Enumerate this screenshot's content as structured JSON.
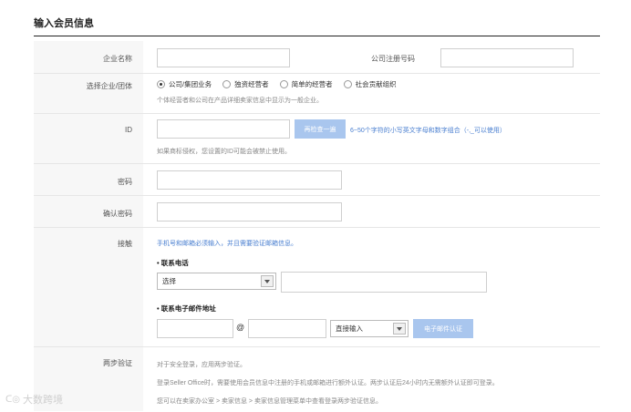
{
  "page": {
    "title": "输入会员信息"
  },
  "rows": {
    "company": {
      "label": "企业名称",
      "reg_label": "公司注册号码"
    },
    "type": {
      "label": "选择企业/团体",
      "options": [
        "公司/集团业务",
        "独资经营者",
        "简单的经营者",
        "社会贡献组织"
      ],
      "selected_index": 0,
      "hint": "个体经营者和公司在产品详细卖家信息中显示为一般企业。"
    },
    "id": {
      "label": "ID",
      "check_button": "再检查一遍",
      "rule_hint": "6~50个字符的小写英文字母和数字组合（-,_可以使用）",
      "hint": "如果商标侵权，您设置的ID可能会被禁止使用。"
    },
    "password": {
      "label": "密码"
    },
    "password_confirm": {
      "label": "确认密码"
    },
    "contact": {
      "label": "接触",
      "hint": "手机号和邮箱必须输入，并且需要验证邮箱信息。",
      "phone_heading": "• 联系电话",
      "phone_select": "选择",
      "email_heading": "• 联系电子邮件地址",
      "at": "@",
      "domain_select": "直接输入",
      "email_verify_button": "电子邮件认证"
    },
    "two_step": {
      "label": "两步验证",
      "line1": "对于安全登录，应用两步验证。",
      "line2": "登录Seller Office时，需要使用会员信息中注册的手机或邮箱进行额外认证。两步认证后24小时内无需额外认证即可登录。",
      "line3": "您可以在卖家办公室 > 卖家信息 > 卖家信息管理菜单中查看登录两步验证信息。"
    }
  },
  "watermark": {
    "text": "大数跨境"
  }
}
